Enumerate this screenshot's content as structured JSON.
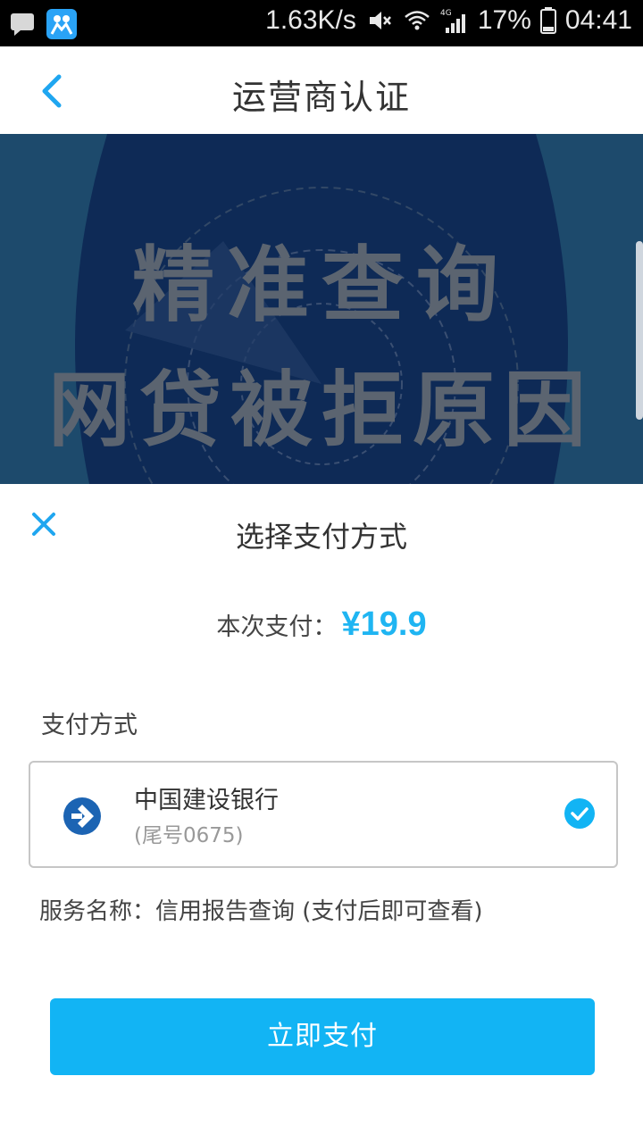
{
  "status_bar": {
    "net_speed": "1.63K/s",
    "network": "4G",
    "battery": "17%",
    "time": "04:41"
  },
  "header": {
    "title": "运营商认证"
  },
  "banner": {
    "line1": "精准查询",
    "line2": "网贷被拒原因"
  },
  "sheet": {
    "title": "选择支付方式",
    "amount_label": "本次支付：",
    "amount_value": "¥19.9",
    "method_heading": "支付方式",
    "bank": {
      "name": "中国建设银行",
      "tail": "(尾号0675)"
    },
    "service_info": "服务名称：信用报告查询 (支付后即可查看)",
    "pay_button": "立即支付"
  },
  "colors": {
    "accent": "#12b4f4",
    "amount": "#1fb5f2",
    "bank_logo": "#1c64b3",
    "banner_bg": "#0f2e4e"
  }
}
